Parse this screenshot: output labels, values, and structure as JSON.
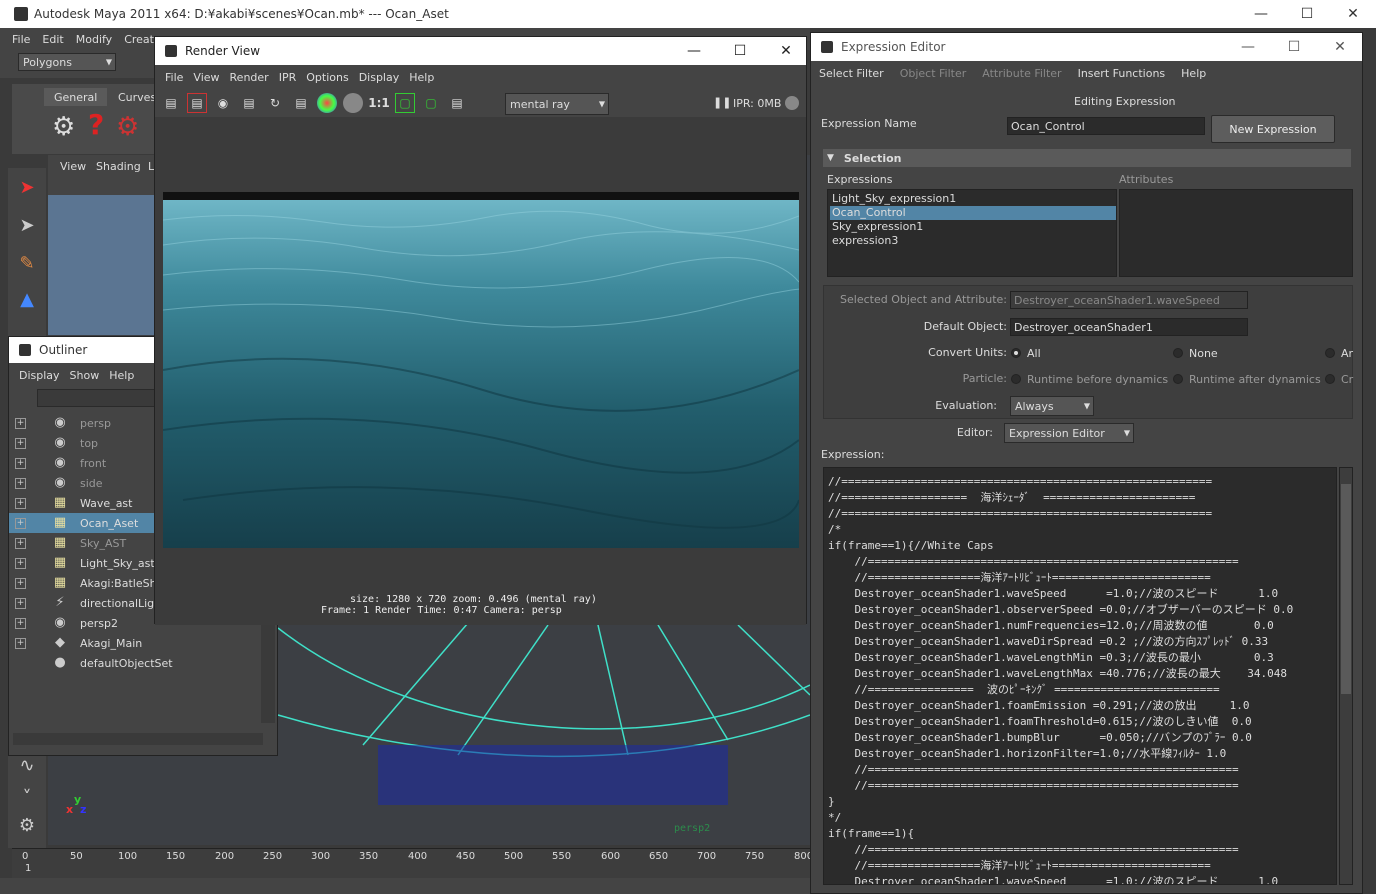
{
  "main_window": {
    "title": "Autodesk Maya 2011 x64: D:¥akabi¥scenes¥Ocan.mb*  ---  Ocan_Aset",
    "menu": [
      "File",
      "Edit",
      "Modify",
      "Creat"
    ],
    "mode_dropdown": "Polygons",
    "shelf_tabs": [
      "General",
      "Curves"
    ],
    "viewport_menu": [
      "View",
      "Shading",
      "L"
    ],
    "camera_label": "persp2",
    "timeline_ticks": [
      "0",
      "50",
      "100",
      "150",
      "200",
      "250",
      "300",
      "350",
      "400",
      "450",
      "500",
      "550",
      "600",
      "650",
      "700",
      "750",
      "800"
    ],
    "timeline_current": "1"
  },
  "outliner": {
    "title": "Outliner",
    "menu": [
      "Display",
      "Show",
      "Help"
    ],
    "items": [
      {
        "label": "persp",
        "icon": "camera-icon",
        "dim": true
      },
      {
        "label": "top",
        "icon": "camera-icon",
        "dim": true
      },
      {
        "label": "front",
        "icon": "camera-icon",
        "dim": true
      },
      {
        "label": "side",
        "icon": "camera-icon",
        "dim": true
      },
      {
        "label": "Wave_ast",
        "icon": "group-icon",
        "dim": false
      },
      {
        "label": "Ocan_Aset",
        "icon": "group-icon",
        "dim": false,
        "selected": true
      },
      {
        "label": "Sky_AST",
        "icon": "group-icon",
        "dim": true
      },
      {
        "label": "Light_Sky_ast",
        "icon": "group-icon",
        "dim": false
      },
      {
        "label": "Akagi:BatleShi",
        "icon": "group-icon",
        "dim": false
      },
      {
        "label": "directionalLigh",
        "icon": "light-icon",
        "dim": false
      },
      {
        "label": "persp2",
        "icon": "camera-icon",
        "dim": false
      },
      {
        "label": "Akagi_Main",
        "icon": "joint-icon",
        "dim": false
      },
      {
        "label": "defaultObjectSet",
        "icon": "set-icon",
        "dim": false
      }
    ]
  },
  "render_view": {
    "title": "Render View",
    "menu": [
      "File",
      "View",
      "Render",
      "IPR",
      "Options",
      "Display",
      "Help"
    ],
    "renderer": "mental ray",
    "ratio_label": "1:1",
    "ipr_label": "IPR: 0MB",
    "info_line1": "size: 1280 x 720 zoom: 0.496      (mental ray)",
    "info_line2": "Frame: 1        Render Time: 0:47        Camera: persp"
  },
  "expression_editor": {
    "title": "Expression Editor",
    "menu": [
      {
        "label": "Select Filter",
        "dim": false
      },
      {
        "label": "Object Filter",
        "dim": true
      },
      {
        "label": "Attribute Filter",
        "dim": true
      },
      {
        "label": "Insert Functions",
        "dim": false
      },
      {
        "label": "Help",
        "dim": false
      }
    ],
    "heading": "Editing Expression",
    "name_label": "Expression Name",
    "name_value": "Ocan_Control",
    "new_button": "New Expression",
    "selection_header": "Selection",
    "expressions_label": "Expressions",
    "attributes_label": "Attributes",
    "expressions": [
      "Light_Sky_expression1",
      "Ocan_Control",
      "Sky_expression1",
      "expression3"
    ],
    "selected_expression": "Ocan_Control",
    "selected_obj_label": "Selected Object and Attribute:",
    "selected_obj_value": "Destroyer_oceanShader1.waveSpeed",
    "default_obj_label": "Default Object:",
    "default_obj_value": "Destroyer_oceanShader1",
    "convert_units_label": "Convert Units:",
    "convert_units_options": [
      "All",
      "None",
      "Ar"
    ],
    "particle_label": "Particle:",
    "particle_options": [
      "Runtime before dynamics",
      "Runtime after dynamics",
      "Cr"
    ],
    "evaluation_label": "Evaluation:",
    "evaluation_value": "Always",
    "editor_label": "Editor:",
    "editor_value": "Expression Editor",
    "expression_label": "Expression:",
    "code_lines": [
      "//========================================================",
      "//===================  海洋ｼｪｰﾀﾞ  =======================",
      "//========================================================",
      "/*",
      "if(frame==1){//White Caps",
      "    //========================================================",
      "    //=================海洋ｱｰﾄﾘﾋﾞｭｰﾄ========================",
      "    Destroyer_oceanShader1.waveSpeed      =1.0;//波のスピード      1.0",
      "    Destroyer_oceanShader1.observerSpeed =0.0;//オブザーバーのスピード 0.0",
      "    Destroyer_oceanShader1.numFrequencies=12.0;//周波数の値       0.0",
      "    Destroyer_oceanShader1.waveDirSpread =0.2 ;//波の方向ｽﾌﾟﾚｯﾄﾞ 0.33",
      "    Destroyer_oceanShader1.waveLengthMin =0.3;//波長の最小        0.3",
      "    Destroyer_oceanShader1.waveLengthMax =40.776;//波長の最大    34.048",
      "    //================  波のﾋﾟｰｷﾝｸﾞ =========================",
      "    Destroyer_oceanShader1.foamEmission =0.291;//波の放出     1.0",
      "    Destroyer_oceanShader1.foamThreshold=0.615;//波のしきい値  0.0",
      "    Destroyer_oceanShader1.bumpBlur      =0.050;//バンプのﾌﾞﾗｰ 0.0",
      "    Destroyer_oceanShader1.horizonFilter=1.0;//水平線ﾌｨﾙﾀｰ 1.0",
      "    //========================================================",
      "    //========================================================",
      "}",
      "*/",
      "if(frame==1){",
      "    //========================================================",
      "    //=================海洋ｱｰﾄﾘﾋﾞｭｰﾄ========================",
      "    Destroyer_oceanShader1.waveSpeed      =1.0;//波のスピード      1.0"
    ]
  },
  "colors": {
    "selection_blue": "#5285a6",
    "panel_bg": "#444444",
    "ocean": "#2f6b7a",
    "grid_cyan": "#3fe0c8"
  }
}
